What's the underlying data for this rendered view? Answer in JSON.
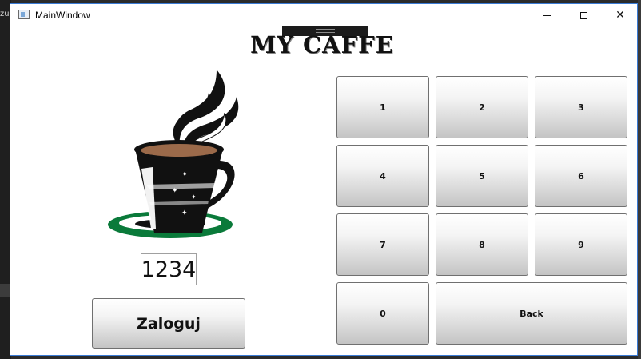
{
  "desktop": {
    "edge_text": "zu"
  },
  "window": {
    "title": "MainWindow"
  },
  "app": {
    "title": "MY CAFFE"
  },
  "login": {
    "pin_value": "1234",
    "button_label": "Zaloguj"
  },
  "keypad": {
    "k1": "1",
    "k2": "2",
    "k3": "3",
    "k4": "4",
    "k5": "5",
    "k6": "6",
    "k7": "7",
    "k8": "8",
    "k9": "9",
    "k0": "0",
    "back": "Back"
  },
  "icons": {
    "app": "window-icon",
    "minimize": "minimize-icon",
    "maximize": "maximize-icon",
    "close": "close-icon",
    "logo": "coffee-cup-icon"
  },
  "colors": {
    "saucer": "#0a7a3a",
    "cup": "#111111",
    "coffee": "#9b6a4a",
    "window_border": "#3a7bd5"
  }
}
